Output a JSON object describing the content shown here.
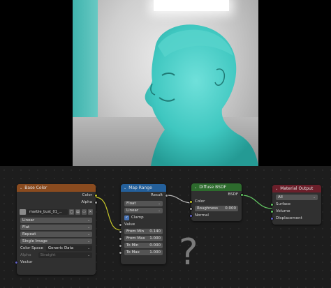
{
  "colors": {
    "image_header": "#8a4b1f",
    "map_range_header": "#24609b",
    "bsdf_header": "#2d6b2d",
    "output_header": "#6b1f2a",
    "socket_color": "#c7c729",
    "socket_float": "#a1a1a1",
    "socket_vector": "#6363c7",
    "socket_shader": "#63c763",
    "bust": "#3fc7c0"
  },
  "image_node": {
    "title": "Base Color",
    "outputs": [
      "Color",
      "Alpha"
    ],
    "image_name": "marble_bust_01_...",
    "interpolation": "Linear",
    "projection": "Flat",
    "extension": "Repeat",
    "source": "Single Image",
    "color_space_label": "Color Space",
    "color_space": "Generic Data",
    "alpha_label": "Alpha",
    "alpha_value": "Straight",
    "vector_label": "Vector"
  },
  "map_range_node": {
    "title": "Map Range",
    "output": "Result",
    "data_type": "Float",
    "interpolation": "Linear",
    "clamp_label": "Clamp",
    "value_label": "Value",
    "fields": [
      {
        "label": "From Min",
        "value": "0.140"
      },
      {
        "label": "From Max",
        "value": "1.000"
      },
      {
        "label": "To Min",
        "value": "0.000"
      },
      {
        "label": "To Max",
        "value": "1.000"
      }
    ]
  },
  "bsdf_node": {
    "title": "Diffuse BSDF",
    "output": "BSDF",
    "color_label": "Color",
    "roughness_label": "Roughness",
    "roughness_value": "0.000",
    "normal_label": "Normal"
  },
  "output_node": {
    "title": "Material Output",
    "target": "All",
    "inputs": [
      "Surface",
      "Volume",
      "Displacement"
    ]
  },
  "overlay": {
    "question_mark": "?"
  }
}
